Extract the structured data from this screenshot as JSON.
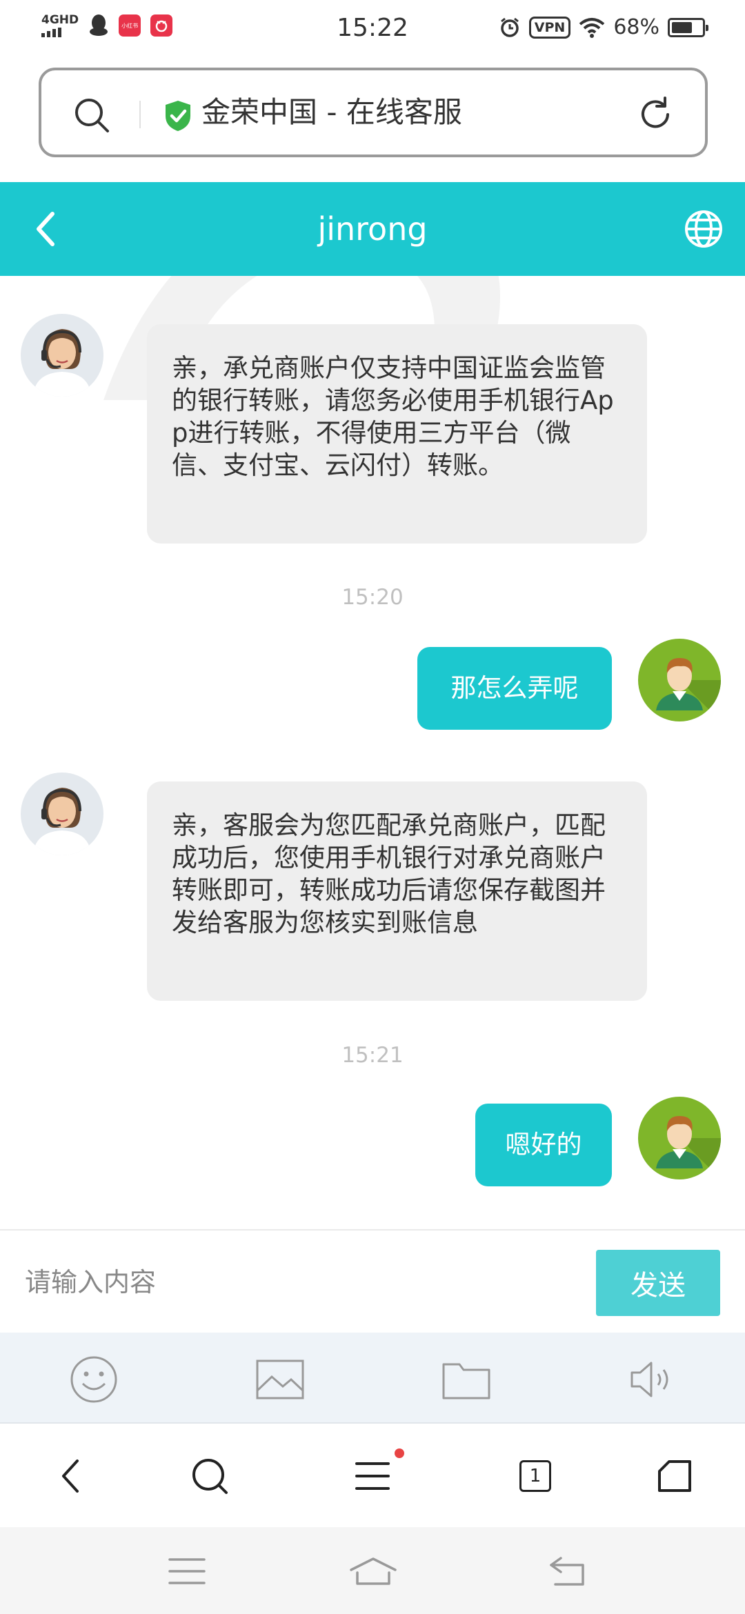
{
  "status_bar": {
    "network": "4GHD",
    "app_badge_1": "小红书",
    "time": "15:22",
    "vpn_label": "VPN",
    "battery_percent": "68%",
    "battery_level": 0.68
  },
  "address_bar": {
    "title": "金荣中国 - 在线客服"
  },
  "header": {
    "title": "jinrong"
  },
  "messages": [
    {
      "from": "agent",
      "text": "亲，承兑商账户仅支持中国证监会监管的银行转账，请您务必使用手机银行App进行转账，不得使用三方平台（微信、支付宝、云闪付）转账。"
    },
    {
      "timestamp": "15:20"
    },
    {
      "from": "user",
      "text": "那怎么弄呢"
    },
    {
      "from": "agent",
      "text": "亲，客服会为您匹配承兑商账户，匹配成功后，您使用手机银行对承兑商账户转账即可，转账成功后请您保存截图并发给客服为您核实到账信息"
    },
    {
      "timestamp": "15:21"
    },
    {
      "from": "user",
      "text": "嗯好的"
    }
  ],
  "input": {
    "placeholder": "请输入内容",
    "send_label": "发送"
  },
  "toolbar": {
    "icons": [
      "emoji-icon",
      "image-icon",
      "folder-icon",
      "voice-icon"
    ]
  },
  "browser_nav": {
    "tab_count": "1"
  },
  "colors": {
    "accent": "#1cc8cf",
    "send_button": "#4ed0d4",
    "agent_bubble": "#eeeeee",
    "user_avatar_bg": "#7fb62a"
  }
}
